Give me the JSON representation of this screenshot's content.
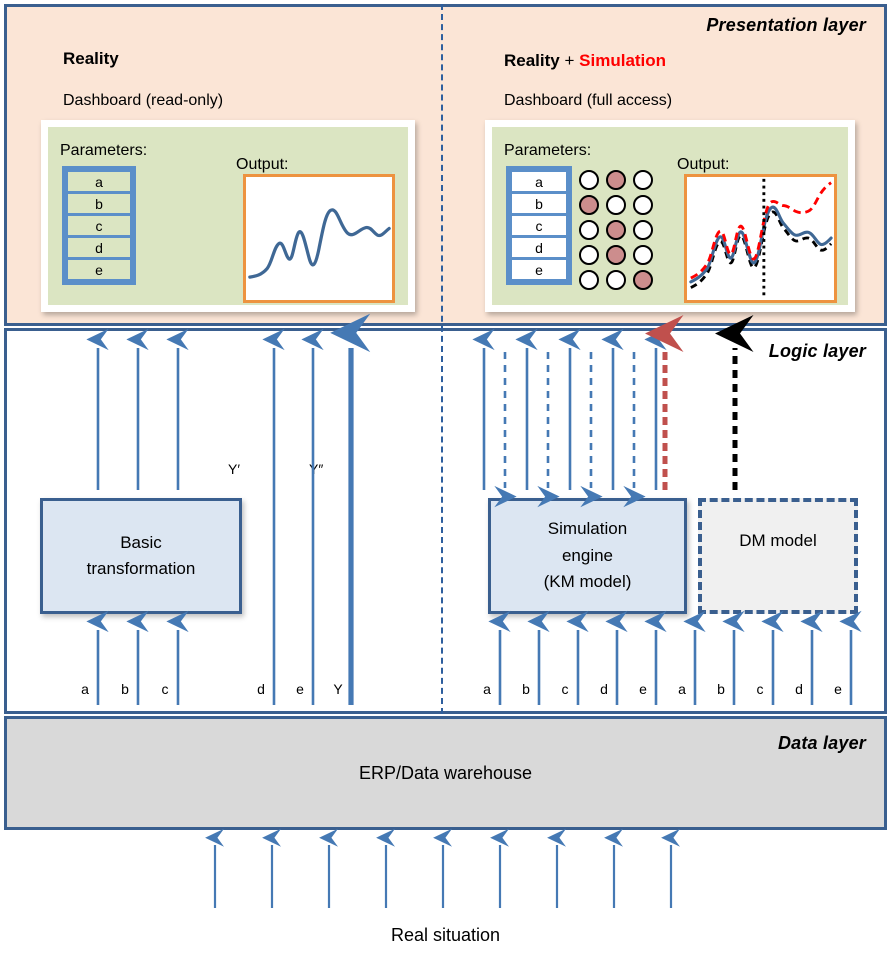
{
  "layers": {
    "presentation": {
      "label": "Presentation layer"
    },
    "logic": {
      "label": "Logic layer"
    },
    "data": {
      "label": "Data layer",
      "box_label": "ERP/Data warehouse"
    }
  },
  "left_panel": {
    "title": "Reality",
    "dashboard_caption": "Dashboard (read-only)",
    "parameters_heading": "Parameters:",
    "output_heading": "Output:",
    "parameters": [
      "a",
      "b",
      "c",
      "d",
      "e"
    ]
  },
  "right_panel": {
    "title_main": "Reality",
    "title_plus": "+",
    "title_sim": "Simulation",
    "sim_color": "#ff0000",
    "dashboard_caption": "Dashboard (full access)",
    "parameters_heading": "Parameters:",
    "output_heading": "Output:",
    "parameters": [
      "a",
      "b",
      "c",
      "d",
      "e"
    ],
    "radio_rows": [
      {
        "param": "a",
        "selected": 1
      },
      {
        "param": "b",
        "selected": 0
      },
      {
        "param": "c",
        "selected": 1
      },
      {
        "param": "d",
        "selected": 1
      },
      {
        "param": "e",
        "selected": 2
      }
    ],
    "radio_columns": 3,
    "radio_on_color": "#cc8d8d"
  },
  "logic": {
    "basic_transformation_line1": "Basic",
    "basic_transformation_line2": "transformation",
    "simulation_engine_line1": "Simulation",
    "simulation_engine_line2": "engine",
    "simulation_engine_line3": "(KM model)",
    "dm_model": "DM model",
    "left_input_labels": [
      "a",
      "b",
      "c"
    ],
    "left_passthrough_labels": [
      "d",
      "e",
      "Y"
    ],
    "right_input_labels": [
      "a",
      "b",
      "c",
      "d",
      "e",
      "a",
      "b",
      "c",
      "d",
      "e"
    ],
    "y_prime_label": "Y′",
    "y_double_prime_label": "Y″"
  },
  "bottom": {
    "caption": "Real situation",
    "arrow_count": 9
  },
  "colors": {
    "panel_border": "#3a5f8f",
    "presentation_bg": "#fbe5d6",
    "logic_bg": "#ffffff",
    "data_bg": "#d9d9d9",
    "dashboard_bg": "#dbe5c2",
    "chart_border": "#ed9340",
    "arrow_blue": "#4579b4",
    "arrow_red": "#c0504d",
    "arrow_black": "#000000",
    "box_fill": "#dce6f2",
    "param_border": "#5b8fc9"
  },
  "chart_data": [
    {
      "type": "line",
      "name": "reality-output-chart",
      "title": "Output:",
      "xlabel": "",
      "ylabel": "",
      "grid": false,
      "legend": "none",
      "xlim": [
        0,
        100
      ],
      "ylim": [
        0,
        100
      ],
      "series": [
        {
          "name": "Reality",
          "color": "#3f6895",
          "style": "solid",
          "x": [
            0,
            5,
            10,
            15,
            20,
            25,
            30,
            35,
            40,
            45,
            50,
            55,
            60,
            65,
            70,
            75,
            80,
            85,
            90,
            95,
            100
          ],
          "y": [
            20,
            21,
            24,
            34,
            47,
            36,
            27,
            52,
            45,
            22,
            38,
            74,
            82,
            70,
            62,
            64,
            60,
            63,
            66,
            57,
            61
          ]
        }
      ]
    },
    {
      "type": "line",
      "name": "simulation-output-chart",
      "title": "Output:",
      "xlabel": "",
      "ylabel": "",
      "grid": false,
      "legend": "none",
      "xlim": [
        0,
        100
      ],
      "ylim": [
        0,
        100
      ],
      "forecast_divider_x": 52,
      "series": [
        {
          "name": "Reality",
          "color": "#3f6895",
          "style": "solid",
          "x": [
            0,
            5,
            10,
            15,
            20,
            25,
            30,
            35,
            40,
            45,
            50,
            55,
            60,
            65,
            70,
            75,
            80,
            85,
            90,
            95,
            100
          ],
          "y": [
            14,
            17,
            21,
            30,
            50,
            33,
            28,
            51,
            38,
            24,
            47,
            74,
            76,
            70,
            62,
            58,
            54,
            58,
            56,
            48,
            54
          ]
        },
        {
          "name": "Simulation",
          "color": "#ff0000",
          "style": "dashed",
          "x": [
            0,
            5,
            10,
            15,
            20,
            25,
            30,
            35,
            40,
            45,
            50,
            55,
            60,
            65,
            70,
            75,
            80,
            85,
            90,
            95,
            100
          ],
          "y": [
            17,
            20,
            24,
            33,
            54,
            37,
            31,
            55,
            42,
            27,
            50,
            79,
            81,
            80,
            76,
            73,
            73,
            76,
            80,
            87,
            94
          ]
        },
        {
          "name": "DM model",
          "color": "#000000",
          "style": "dashed",
          "x": [
            0,
            5,
            10,
            15,
            20,
            25,
            30,
            35,
            40,
            45,
            50,
            55,
            60,
            65,
            70,
            75,
            80,
            85,
            90,
            95,
            100
          ],
          "y": [
            10,
            13,
            17,
            26,
            46,
            29,
            24,
            47,
            34,
            20,
            43,
            72,
            71,
            64,
            55,
            52,
            48,
            52,
            49,
            41,
            47
          ]
        }
      ]
    }
  ]
}
